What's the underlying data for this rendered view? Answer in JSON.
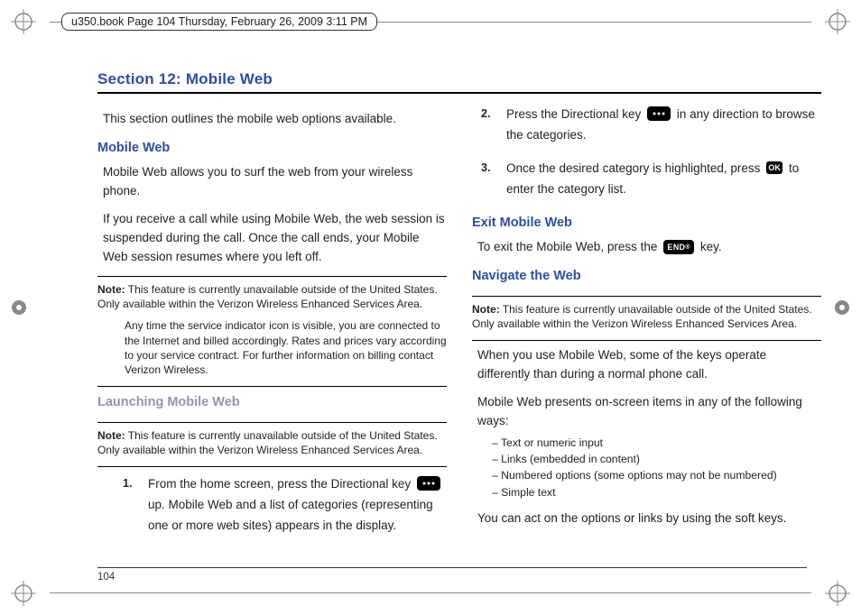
{
  "meta": {
    "framemaker_header": "u350.book  Page 104  Thursday, February 26, 2009  3:11 PM",
    "page_number": "104"
  },
  "title": "Section 12: Mobile Web",
  "left": {
    "intro": "This section outlines the mobile web options available.",
    "h_mobile_web": "Mobile Web",
    "p1": "Mobile Web allows you to surf the web from your wireless phone.",
    "p2": "If you receive a call while using Mobile Web, the web session is suspended during the call. Once the call ends, your Mobile Web session resumes where you left off.",
    "note1_label": "Note:",
    "note1_a": "This feature is currently unavailable outside of the United States. Only available within the Verizon Wireless Enhanced Services Area.",
    "note1_b": "Any time the service indicator icon is visible, you are connected to the Internet and billed accordingly. Rates and prices vary according to your service contract. For further information on billing contact Verizon Wireless.",
    "h_launch": "Launching Mobile Web",
    "note2_label": "Note:",
    "note2": "This feature is currently unavailable outside of the United States. Only available within the Verizon Wireless Enhanced Services Area.",
    "step1_num": "1.",
    "step1_a": "From the home screen, press the Directional key ",
    "step1_b": " up. Mobile Web and a list of categories (representing one or more web sites) appears in the display."
  },
  "right": {
    "step2_num": "2.",
    "step2_a": "Press the Directional key ",
    "step2_b": " in any direction to browse the categories.",
    "step3_num": "3.",
    "step3_a": "Once the desired category is highlighted, press ",
    "step3_b": " to enter the category list.",
    "ok_label": "OK",
    "h_exit": "Exit Mobile Web",
    "exit_a": "To exit the Mobile Web, press the ",
    "exit_b": " key.",
    "end_label": "END",
    "h_nav": "Navigate the Web",
    "note3_label": "Note:",
    "note3": "This feature is currently unavailable outside of the United States. Only available within the Verizon Wireless Enhanced Services Area.",
    "p_nav1": "When you use Mobile Web, some of the keys operate differently than during a normal phone call.",
    "p_nav2": "Mobile Web presents on-screen items in any of the following ways:",
    "list": {
      "i1": "Text or numeric input",
      "i2": "Links (embedded in content)",
      "i3": "Numbered options (some options may not be numbered)",
      "i4": "Simple text"
    },
    "p_nav3": "You can act on the options or links by using the soft keys."
  }
}
